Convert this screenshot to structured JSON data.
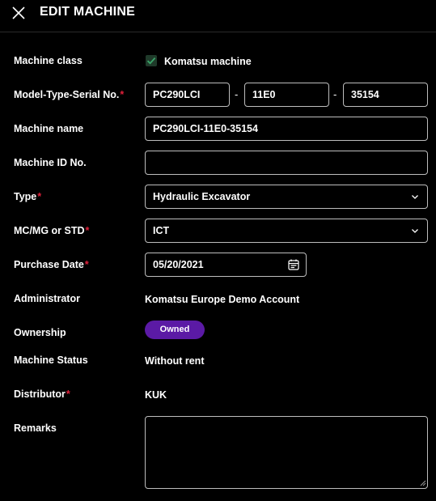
{
  "header": {
    "title": "EDIT MACHINE",
    "close_icon": "close-icon"
  },
  "form": {
    "machine_class": {
      "label": "Machine class",
      "checkbox_label": "Komatsu machine",
      "checked": true
    },
    "model_type_serial": {
      "label": "Model-Type-Serial No.",
      "required": "*",
      "model": "PC290LCI",
      "type": "11E0",
      "serial": "35154",
      "separator": "-"
    },
    "machine_name": {
      "label": "Machine name",
      "value": "PC290LCI-11E0-35154"
    },
    "machine_id": {
      "label": "Machine ID No.",
      "value": ""
    },
    "type": {
      "label": "Type",
      "required": "*",
      "value": "Hydraulic Excavator",
      "icon": "chevron-down-icon"
    },
    "mc_mg_std": {
      "label": "MC/MG or STD",
      "required": "*",
      "value": "ICT",
      "icon": "chevron-down-icon"
    },
    "purchase_date": {
      "label": "Purchase Date",
      "required": "*",
      "value": "05/20/2021",
      "icon": "calendar-icon"
    },
    "administrator": {
      "label": "Administrator",
      "value": "Komatsu Europe Demo Account"
    },
    "ownership": {
      "label": "Ownership",
      "value": "Owned",
      "badge_color": "#5b1aa5"
    },
    "machine_status": {
      "label": "Machine Status",
      "value": "Without rent"
    },
    "distributor": {
      "label": "Distributor",
      "required": "*",
      "value": "KUK"
    },
    "remarks": {
      "label": "Remarks",
      "value": ""
    }
  },
  "colors": {
    "background": "#000000",
    "border": "#bdbdbd",
    "required": "#e0203a",
    "check": "#3aa66a"
  }
}
